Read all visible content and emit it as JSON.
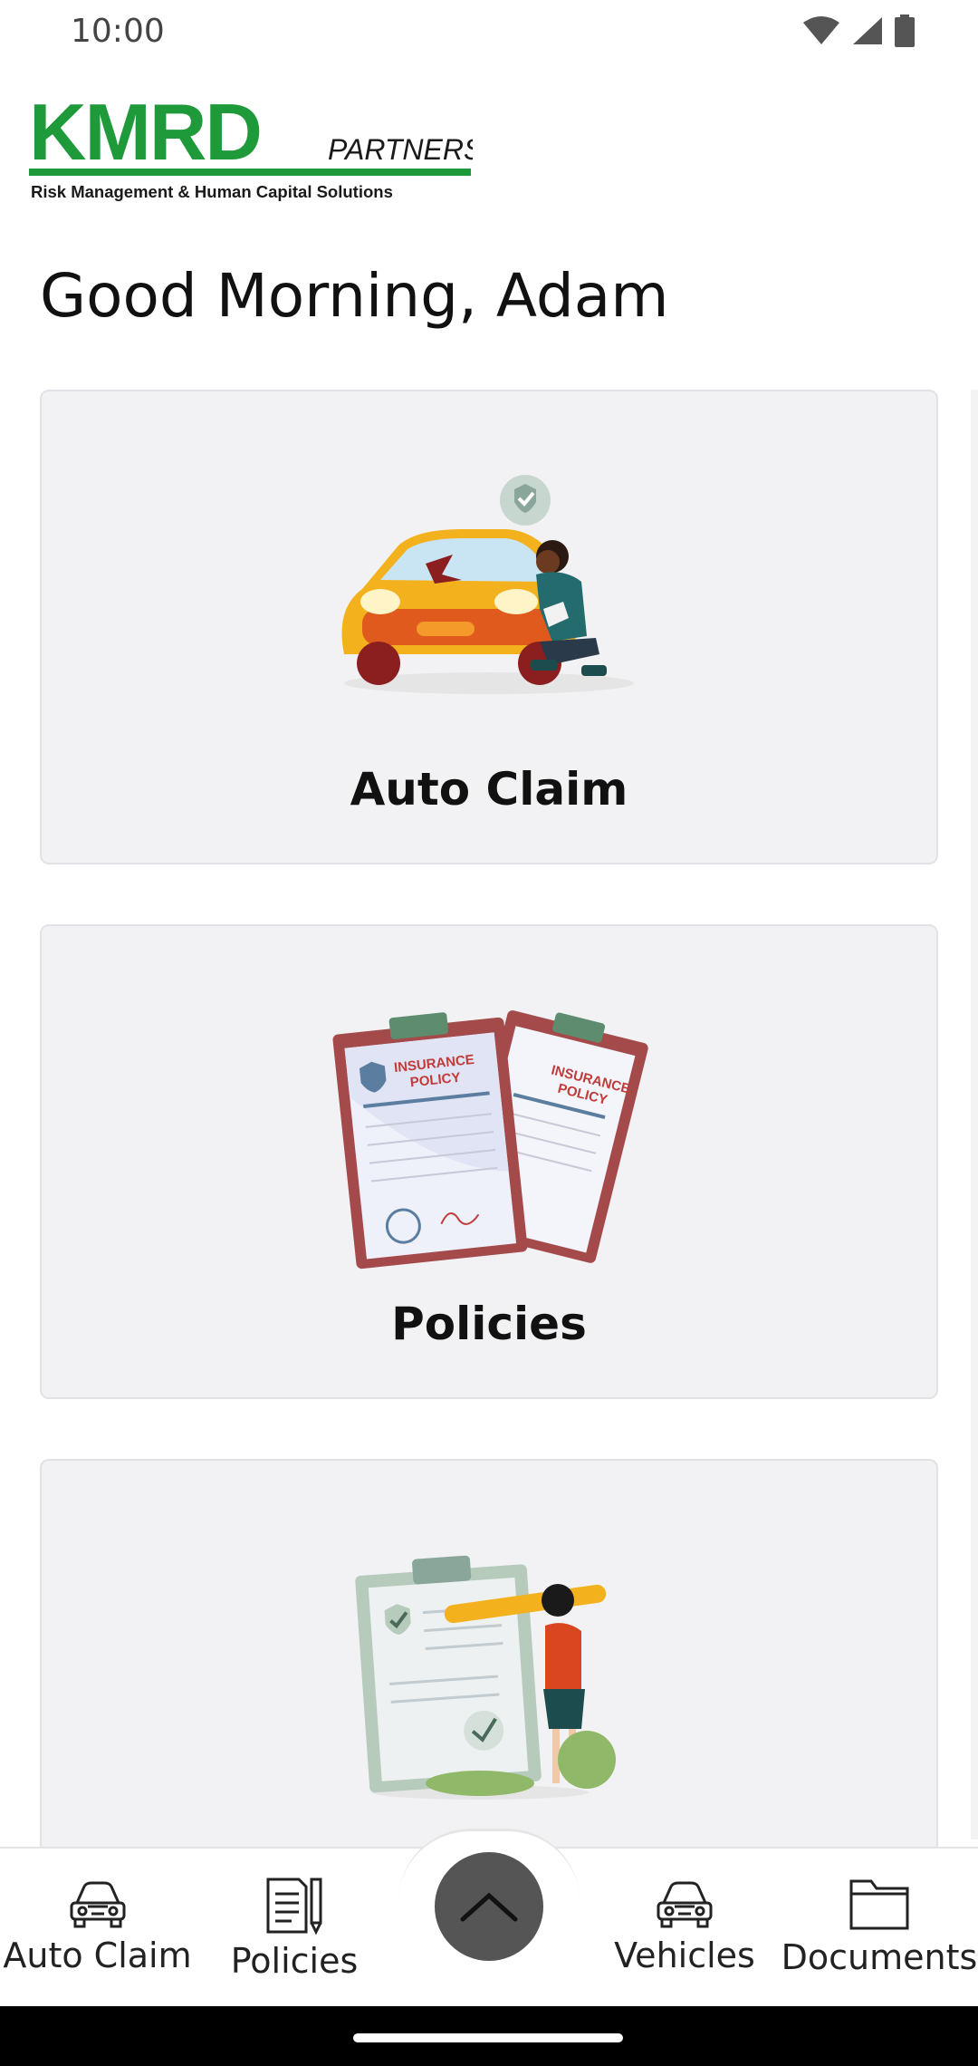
{
  "status_bar": {
    "time": "10:00"
  },
  "logo": {
    "brand": "KMRD",
    "suffix": "PARTNERS",
    "tagline": "Risk Management & Human Capital Solutions",
    "brand_color": "#1f9a3a"
  },
  "greeting": "Good Morning, Adam",
  "cards": [
    {
      "label": "Auto Claim",
      "icon": "car-inspection-illustration"
    },
    {
      "label": "Policies",
      "icon": "insurance-policy-illustration"
    },
    {
      "label": "",
      "icon": "checklist-illustration"
    }
  ],
  "bottom_nav": {
    "items": [
      {
        "label": "Auto Claim",
        "icon": "car-icon"
      },
      {
        "label": "Policies",
        "icon": "document-pen-icon"
      },
      {
        "label": "Vehicles",
        "icon": "car-icon"
      },
      {
        "label": "Documents",
        "icon": "folder-icon"
      }
    ],
    "fab_icon": "chevron-up-icon"
  },
  "colors": {
    "card_bg": "#f2f2f4",
    "fab": "#555555",
    "accent_green": "#1f9a3a"
  }
}
